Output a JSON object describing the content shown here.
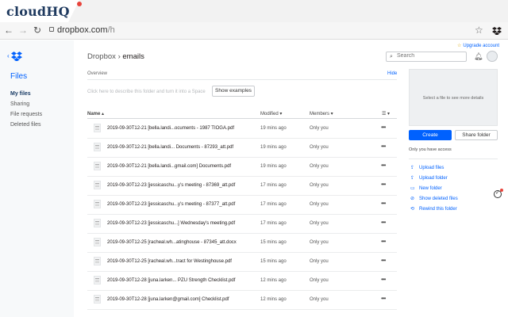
{
  "brand": {
    "logo": "cloudHQ"
  },
  "browser": {
    "url_host": "dropbox.com",
    "url_path": "/h"
  },
  "sidebar": {
    "title": "Files",
    "items": [
      {
        "label": "My files",
        "active": true
      },
      {
        "label": "Sharing",
        "active": false
      },
      {
        "label": "File requests",
        "active": false
      },
      {
        "label": "Deleted files",
        "active": false
      }
    ]
  },
  "header": {
    "breadcrumb_root": "Dropbox",
    "breadcrumb_sep": "›",
    "breadcrumb_current": "emails",
    "search_placeholder": "Search",
    "upgrade": "Upgrade account"
  },
  "overview": {
    "label": "Overview",
    "hide": "Hide",
    "description_placeholder": "Click here to describe this folder and turn it into a Space",
    "examples_button": "Show examples"
  },
  "table": {
    "headers": {
      "name": "Name ▴",
      "modified": "Modified ▾",
      "members": "Members ▾",
      "view": "☰ ▾"
    },
    "rows": [
      {
        "name": "2019-09-30T12-21 [bella.landi...ocuments - 1987 TIOGA.pdf",
        "modified": "19 mins ago",
        "members": "Only you"
      },
      {
        "name": "2019-09-30T12-21 [bella.landi... Documents - 87293_att.pdf",
        "modified": "19 mins ago",
        "members": "Only you"
      },
      {
        "name": "2019-09-30T12-21 [bella.landi...gmail.com] Documents.pdf",
        "modified": "19 mins ago",
        "members": "Only you"
      },
      {
        "name": "2019-09-30T12-23 [jessicaschu...y's meeting - 87369_att.pdf",
        "modified": "17 mins ago",
        "members": "Only you"
      },
      {
        "name": "2019-09-30T12-23 [jessicaschu...y's meeting - 87377_att.pdf",
        "modified": "17 mins ago",
        "members": "Only you"
      },
      {
        "name": "2019-09-30T12-23 [jessicaschu...] Wednesday's meeting.pdf",
        "modified": "17 mins ago",
        "members": "Only you"
      },
      {
        "name": "2019-09-30T12-25 [racheal.wh...atinghouse - 87345_att.docx",
        "modified": "15 mins ago",
        "members": "Only you"
      },
      {
        "name": "2019-09-30T12-25 [racheal.wh...tract for Westinghouse.pdf",
        "modified": "15 mins ago",
        "members": "Only you"
      },
      {
        "name": "2019-09-30T12-28 [juna.larken... PZU Strength Checklist.pdf",
        "modified": "12 mins ago",
        "members": "Only you"
      },
      {
        "name": "2019-09-30T12-28 [juna.larken@gmail.com] Checklist.pdf",
        "modified": "12 mins ago",
        "members": "Only you"
      }
    ],
    "more": "•••"
  },
  "right_panel": {
    "preview_hint": "Select a file to see more details",
    "create": "Create",
    "share_folder": "Share folder",
    "access": "Only you have access",
    "actions": [
      {
        "label": "Upload files",
        "icon": "upload-files-icon"
      },
      {
        "label": "Upload folder",
        "icon": "upload-folder-icon"
      },
      {
        "label": "New folder",
        "icon": "new-folder-icon"
      },
      {
        "label": "Show deleted files",
        "icon": "deleted-files-icon"
      },
      {
        "label": "Rewind this folder",
        "icon": "rewind-icon"
      }
    ]
  },
  "colors": {
    "accent": "#0061fe",
    "brand": "#1f3a5f",
    "notify": "#e8433b"
  }
}
